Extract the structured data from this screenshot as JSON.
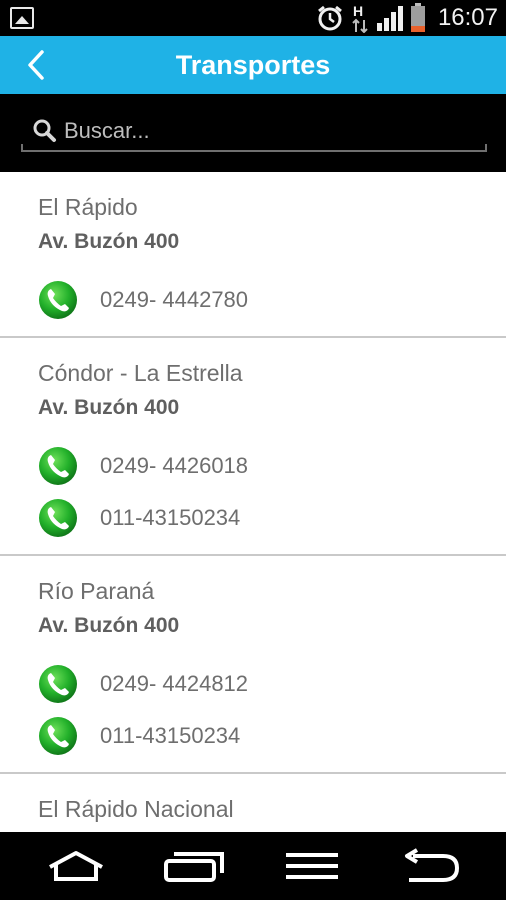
{
  "status_bar": {
    "time": "16:07",
    "icons": [
      "image-notification-icon",
      "alarm-icon",
      "hsdpa-icon",
      "signal-icon",
      "battery-icon"
    ],
    "battery_color": "#e8612c",
    "network_label": "H"
  },
  "header": {
    "title": "Transportes",
    "back_icon": "chevron-left-icon",
    "background": "#1fb2e6"
  },
  "search": {
    "placeholder": "Buscar...",
    "value": ""
  },
  "transports": [
    {
      "name": "El Rápido",
      "address": "Av. Buzón 400",
      "phones": [
        "0249- 4442780"
      ]
    },
    {
      "name": "Cóndor - La Estrella",
      "address": "Av. Buzón 400",
      "phones": [
        "0249- 4426018",
        "011-43150234"
      ]
    },
    {
      "name": "Río Paraná",
      "address": "Av. Buzón 400",
      "phones": [
        "0249- 4424812",
        "011-43150234"
      ]
    },
    {
      "name": "El Rápido Nacional",
      "address": "",
      "phones": []
    }
  ],
  "nav_bar": {
    "icons": [
      "home-icon",
      "recent-apps-icon",
      "menu-icon",
      "back-icon"
    ]
  }
}
